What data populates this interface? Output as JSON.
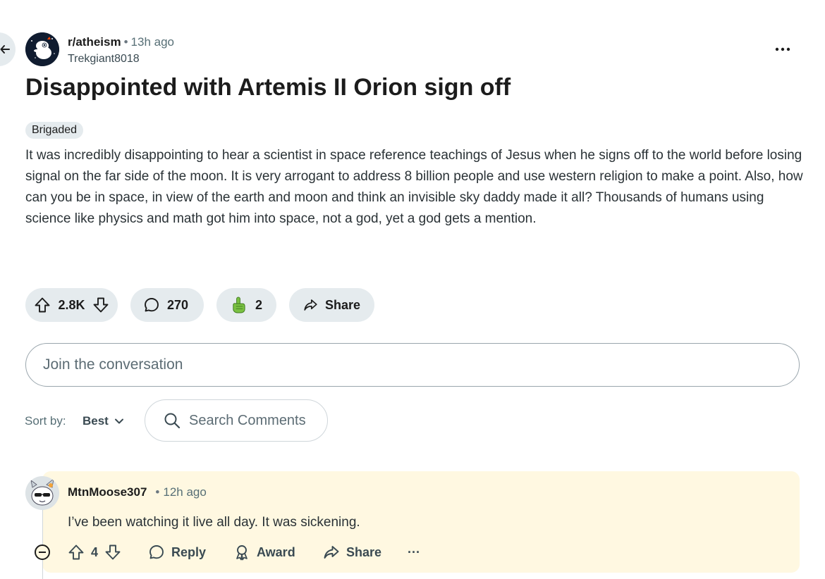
{
  "post": {
    "subreddit": "r/atheism",
    "separator": "•",
    "time": "13h ago",
    "author": "Trekgiant8018",
    "title": "Disappointed with Artemis II Orion sign off",
    "flair": "Brigaded",
    "body": "It was incredibly disappointing to hear a scientist in space reference teachings of Jesus when he signs off to the world before losing signal on the far side of the moon. It is very arrogant to address 8 billion people and use western religion to make a point. Also, how can you be in space, in view of the earth and moon and think an invisible sky daddy made it all? Thousands of humans using science like physics and math got him into space, not a god, yet a god gets a mention.",
    "votes": "2.8K",
    "comments": "270",
    "awards": "2",
    "share_label": "Share"
  },
  "composer": {
    "placeholder": "Join the conversation"
  },
  "sort": {
    "label": "Sort by:",
    "value": "Best",
    "search_placeholder": "Search Comments"
  },
  "comment": {
    "author": "MtnMoose307",
    "separator": "•",
    "time": "12h ago",
    "text": "I’ve been watching it live all day. It was sickening.",
    "votes": "4",
    "reply_label": "Reply",
    "award_label": "Award",
    "share_label": "Share",
    "more_label": "···"
  },
  "colors": {
    "pill_bg": "#e5ebee",
    "highlight_bg": "#fff8e1",
    "award_green": "#7ac142",
    "text_primary": "#1c1c1c",
    "text_meta": "#576f76"
  },
  "icons": {
    "back": "arrow-left-icon",
    "more": "overflow-dots-icon",
    "upvote": "arrow-up-outline-icon",
    "downvote": "arrow-down-outline-icon",
    "comments": "speech-bubble-icon",
    "award": "pointing-hand-award-icon",
    "share": "share-arrow-icon",
    "search": "magnifier-icon",
    "sort_chevron": "chevron-down-icon",
    "collapse": "minus-circle-icon"
  }
}
